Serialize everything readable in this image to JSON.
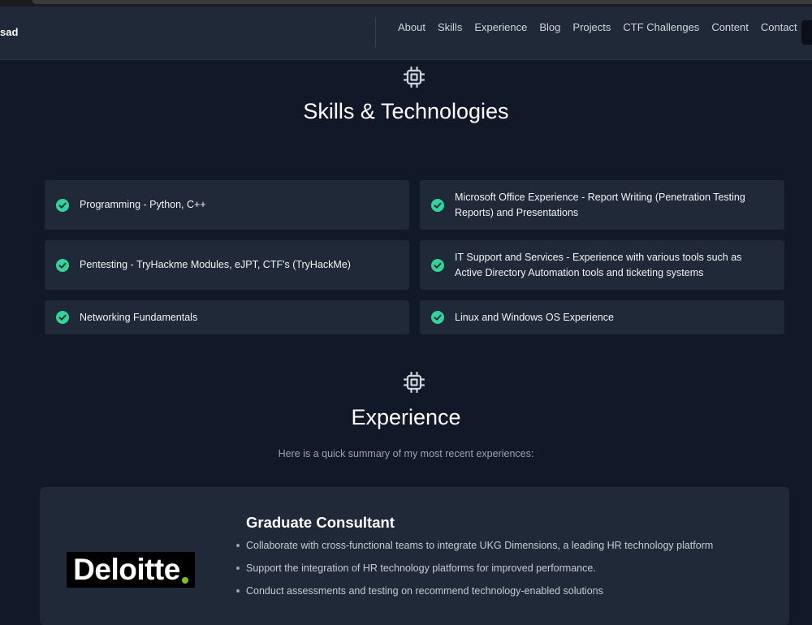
{
  "brand": {
    "name": "sad"
  },
  "nav": {
    "links": [
      "About",
      "Skills",
      "Experience",
      "Blog",
      "Projects",
      "CTF Challenges",
      "Content",
      "Contact"
    ]
  },
  "skills": {
    "icon": "cpu-chip-icon",
    "title": "Skills & Technologies",
    "items": [
      "Programming - Python, C++",
      "Microsoft Office Experience - Report Writing (Penetration Testing Reports) and Presentations",
      "Pentesting - TryHackme Modules, eJPT, CTF's (TryHackMe)",
      "IT Support and Services - Experience with various tools such as Active Directory Automation tools and ticketing systems",
      "Networking Fundamentals",
      "Linux and Windows OS Experience"
    ]
  },
  "experience": {
    "icon": "cpu-chip-icon",
    "title": "Experience",
    "subtitle": "Here is a quick summary of my most recent experiences:",
    "jobs": [
      {
        "company_logo": "Deloitte",
        "title": "Graduate Consultant",
        "bullets": [
          "Collaborate with cross-functional teams to integrate UKG Dimensions, a leading HR technology platform",
          "Support the integration of HR technology platforms for improved performance.",
          "Conduct assessments and testing on recommend technology-enabled solutions"
        ]
      }
    ]
  },
  "colors": {
    "page_bg": "#111827",
    "card_bg": "#1f2937",
    "check_green": "#34d399",
    "logo_dot_green": "#86bc25"
  }
}
